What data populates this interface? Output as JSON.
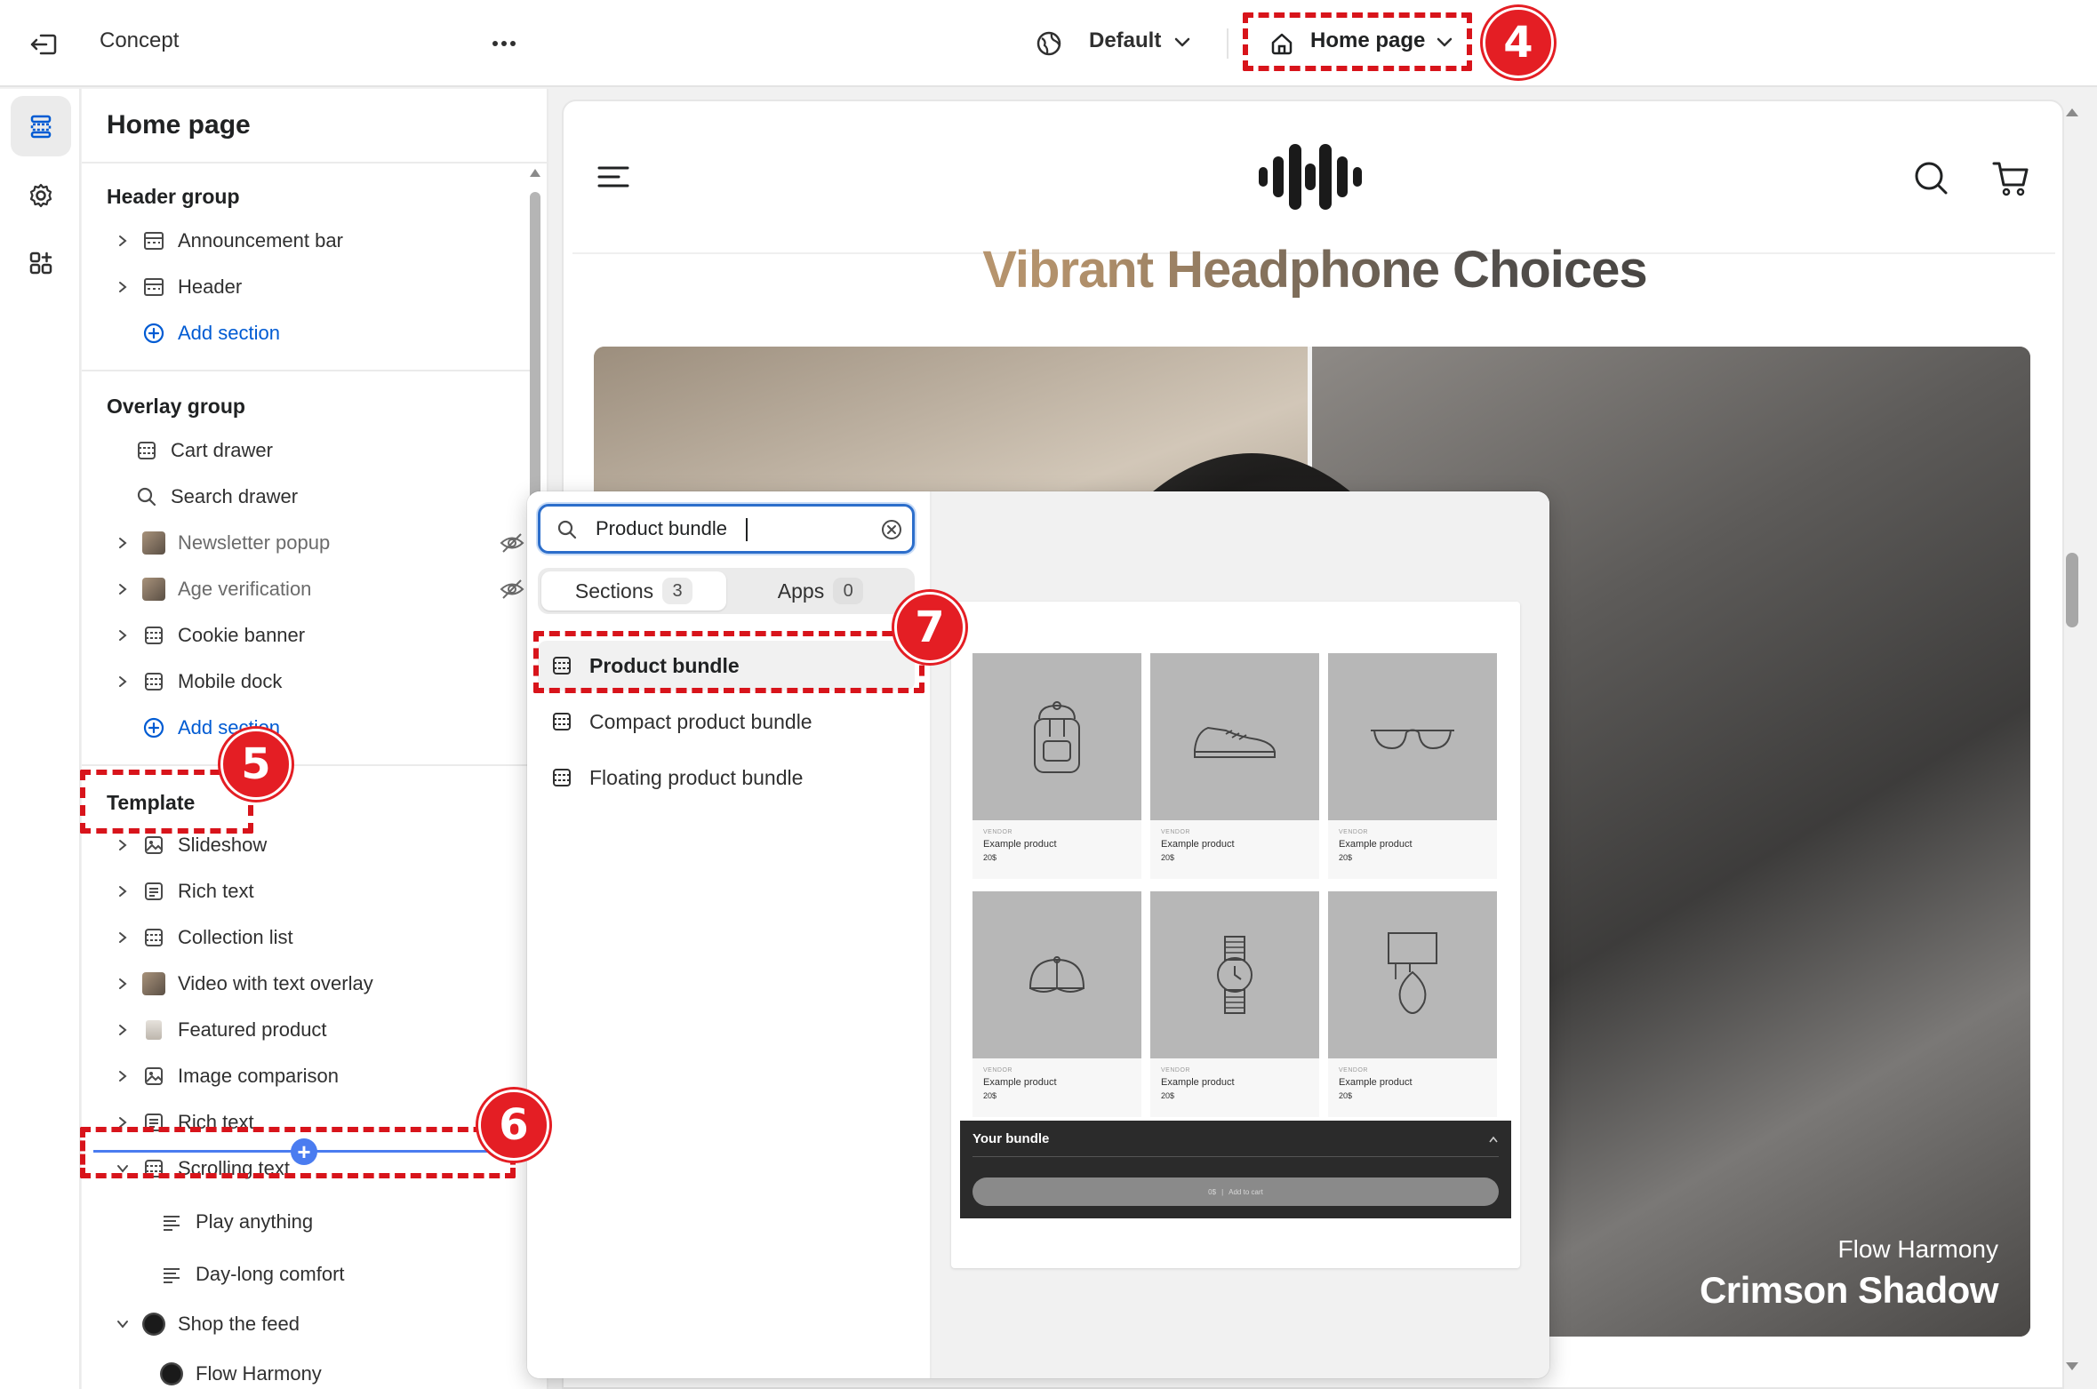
{
  "topbar": {
    "theme_name": "Concept",
    "locale_label": "Default",
    "page_label": "Home page"
  },
  "sidebar": {
    "title": "Home page",
    "header_group": {
      "title": "Header group",
      "items": [
        {
          "label": "Announcement bar"
        },
        {
          "label": "Header"
        }
      ],
      "add_label": "Add section"
    },
    "overlay_group": {
      "title": "Overlay group",
      "items": [
        {
          "label": "Cart drawer"
        },
        {
          "label": "Search drawer"
        },
        {
          "label": "Newsletter popup",
          "hidden": true
        },
        {
          "label": "Age verification",
          "hidden": true
        },
        {
          "label": "Cookie banner"
        },
        {
          "label": "Mobile dock"
        }
      ],
      "add_label": "Add section"
    },
    "template": {
      "title": "Template",
      "items": [
        {
          "label": "Slideshow"
        },
        {
          "label": "Rich text"
        },
        {
          "label": "Collection list"
        },
        {
          "label": "Video with text overlay"
        },
        {
          "label": "Featured product"
        },
        {
          "label": "Image comparison"
        },
        {
          "label": "Rich text"
        },
        {
          "label": "Scrolling text"
        },
        {
          "label": "Play anything"
        },
        {
          "label": "Day-long comfort"
        },
        {
          "label": "Shop the feed"
        },
        {
          "label": "Flow Harmony"
        }
      ]
    }
  },
  "picker": {
    "search_value": "Product bundle",
    "tabs": [
      {
        "label": "Sections",
        "count": "3"
      },
      {
        "label": "Apps",
        "count": "0"
      }
    ],
    "results": [
      {
        "label": "Product bundle"
      },
      {
        "label": "Compact product bundle"
      },
      {
        "label": "Floating product bundle"
      }
    ],
    "preview": {
      "products": [
        {
          "vendor": "VENDOR",
          "name": "Example product",
          "price": "20$",
          "icon": "backpack-icon"
        },
        {
          "vendor": "VENDOR",
          "name": "Example product",
          "price": "20$",
          "icon": "sneaker-icon"
        },
        {
          "vendor": "VENDOR",
          "name": "Example product",
          "price": "20$",
          "icon": "glasses-icon"
        },
        {
          "vendor": "VENDOR",
          "name": "Example product",
          "price": "20$",
          "icon": "cap-icon"
        },
        {
          "vendor": "VENDOR",
          "name": "Example product",
          "price": "20$",
          "icon": "watch-icon"
        },
        {
          "vendor": "VENDOR",
          "name": "Example product",
          "price": "20$",
          "icon": "lamp-icon"
        }
      ],
      "bundle_title": "Your bundle",
      "bundle_total": "0$",
      "bundle_button": "Add to cart"
    }
  },
  "storefront": {
    "headline": "Vibrant Headphone Choices",
    "hero_caption_small": "Flow Harmony",
    "hero_caption_large": "Crimson Shadow"
  },
  "annotations": [
    "4",
    "5",
    "6",
    "7"
  ],
  "colors": {
    "accent": "#005bd3",
    "annotation": "#e41e24",
    "insert_line": "#4a7cf0"
  }
}
